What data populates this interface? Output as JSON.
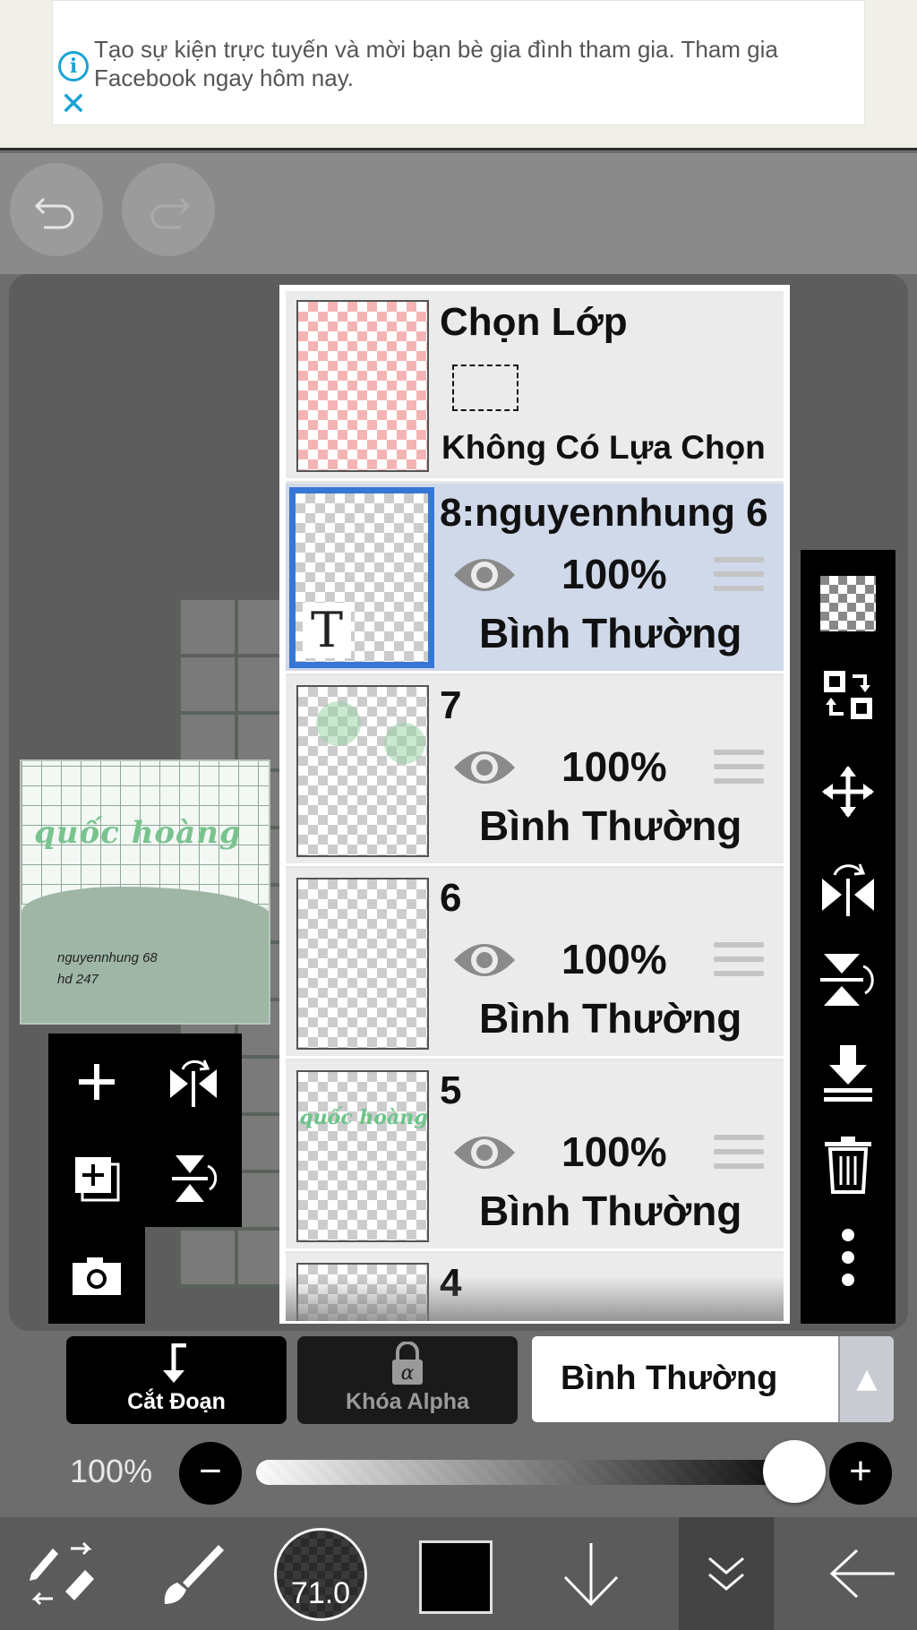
{
  "ad": {
    "text": "Tạo sự kiện trực tuyến và mời bạn bè gia đình tham gia. Tham gia Facebook ngay hôm nay."
  },
  "preview": {
    "title": "quốc hoàng",
    "line1": "nguyennhung  68",
    "line2": "hd  247"
  },
  "layers_panel": {
    "selection": {
      "title": "Chọn Lớp",
      "subtitle": "Không Có Lựa Chọn"
    },
    "layers": [
      {
        "name": "8:nguyennhung 6",
        "opacity": "100%",
        "blend": "Bình Thường",
        "active": true
      },
      {
        "name": "7",
        "opacity": "100%",
        "blend": "Bình Thường",
        "active": false
      },
      {
        "name": "6",
        "opacity": "100%",
        "blend": "Bình Thường",
        "active": false
      },
      {
        "name": "5",
        "opacity": "100%",
        "blend": "Bình Thường",
        "active": false
      },
      {
        "name": "4",
        "opacity": "",
        "blend": "",
        "active": false
      }
    ],
    "layer5_thumb_text": "quốc hoàng"
  },
  "bottom_controls": {
    "clip_label": "Cắt Đoạn",
    "alpha_lock_label": "Khóa Alpha",
    "blend_mode": "Bình Thường",
    "opacity_label": "100%",
    "opacity_value": 1.0
  },
  "bottom_nav": {
    "brush_size": "71.0",
    "color": "#000000"
  },
  "colors": {
    "accent_blue": "#3677d6",
    "active_row": "#cfd9ea",
    "ad_icon": "#1aa3d4"
  }
}
